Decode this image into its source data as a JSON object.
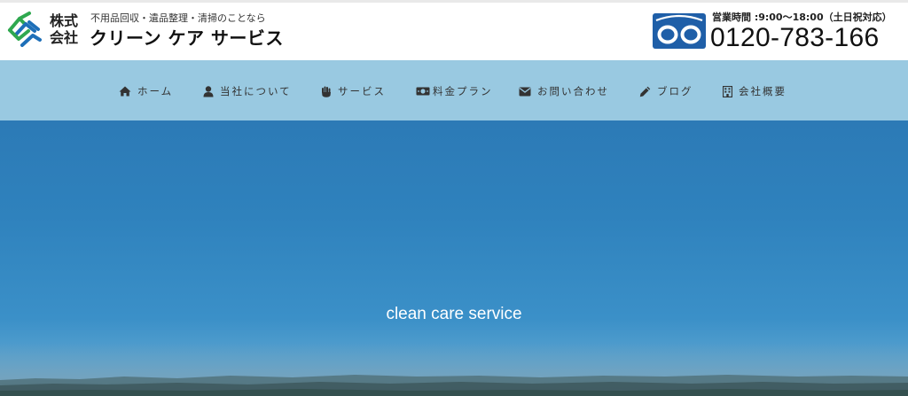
{
  "header": {
    "kaisha": "株式\n会社",
    "tagline": "不用品回収・遺品整理・清掃のことなら",
    "company_name": "クリーン ケア サービス",
    "hours": "営業時間 :9:00〜18:00（土日祝対応）",
    "phone": "0120-783-166"
  },
  "nav": {
    "items": [
      {
        "label": "ホーム",
        "icon": "home-icon"
      },
      {
        "label": "当社について",
        "icon": "user-icon"
      },
      {
        "label": "サービス",
        "icon": "hand-icon"
      },
      {
        "label": "料金プラン",
        "icon": "money-icon"
      },
      {
        "label": "お問い合わせ",
        "icon": "mail-icon"
      },
      {
        "label": "ブログ",
        "icon": "pencil-icon"
      },
      {
        "label": "会社概要",
        "icon": "building-icon"
      }
    ]
  },
  "hero": {
    "text": "clean care service"
  },
  "colors": {
    "nav_bg": "#99c9e1",
    "hero_sky": "#2f82bd",
    "logo_green": "#2fa84f",
    "logo_blue": "#1e6fb8",
    "freedial_blue": "#1f5fa8"
  }
}
